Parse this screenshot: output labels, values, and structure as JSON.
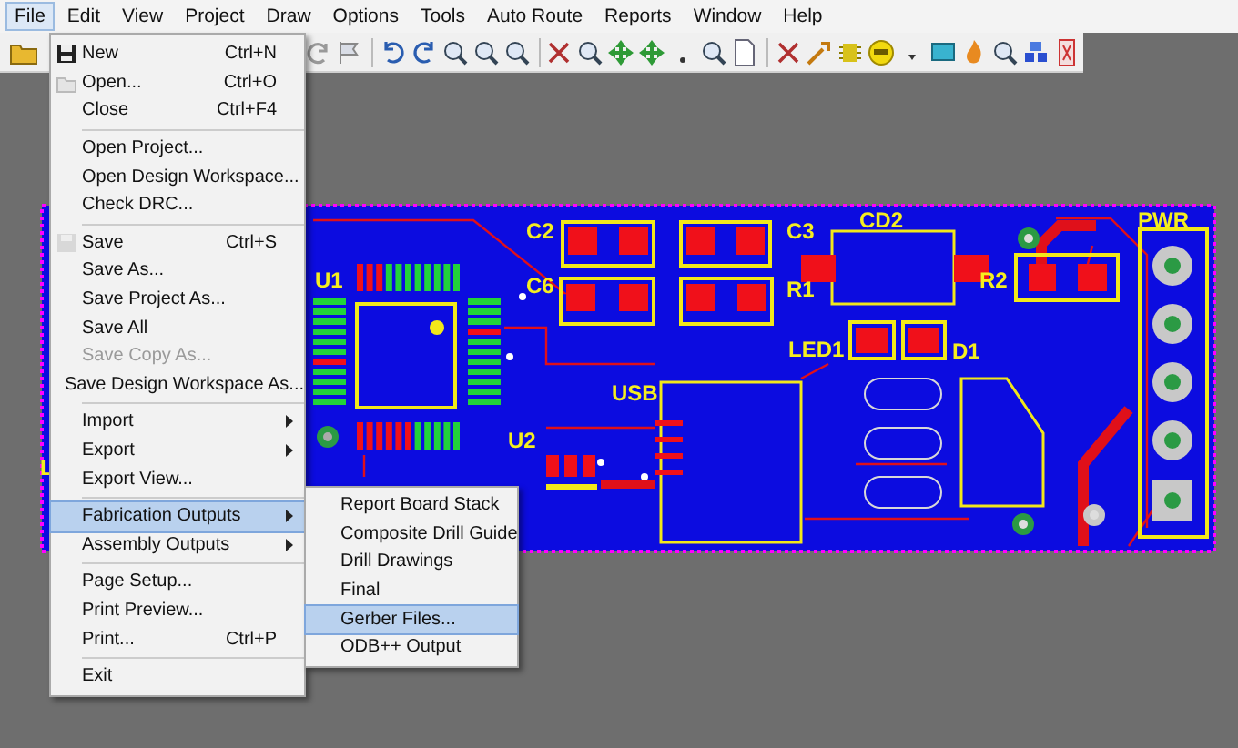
{
  "menubar": [
    {
      "label": "File",
      "selected": true
    },
    {
      "label": "Edit",
      "selected": false
    },
    {
      "label": "View",
      "selected": false
    },
    {
      "label": "Project",
      "selected": false
    },
    {
      "label": "Draw",
      "selected": false
    },
    {
      "label": "Options",
      "selected": false
    },
    {
      "label": "Tools",
      "selected": false
    },
    {
      "label": "Auto Route",
      "selected": false
    },
    {
      "label": "Reports",
      "selected": false
    },
    {
      "label": "Window",
      "selected": false
    },
    {
      "label": "Help",
      "selected": false
    }
  ],
  "board_labels": [
    "C2",
    "C3",
    "CD2",
    "PWR",
    "U1",
    "C6",
    "R1",
    "R2",
    "LED1",
    "D1",
    "USB",
    "U2",
    "L"
  ],
  "file_menu": [
    [
      {
        "label": "New",
        "shortcut": "Ctrl+N",
        "disabled": false,
        "submenu": false,
        "selected": false
      },
      {
        "label": "Open...",
        "shortcut": "Ctrl+O",
        "disabled": false,
        "submenu": false,
        "selected": false
      },
      {
        "label": "Close",
        "shortcut": "Ctrl+F4",
        "disabled": false,
        "submenu": false,
        "selected": false
      }
    ],
    [
      {
        "label": "Open Project...",
        "disabled": false,
        "submenu": false,
        "selected": false
      },
      {
        "label": "Open Design Workspace...",
        "disabled": false,
        "submenu": false,
        "selected": false
      },
      {
        "label": "Check DRC...",
        "disabled": false,
        "submenu": false,
        "selected": false
      }
    ],
    [
      {
        "label": "Save",
        "shortcut": "Ctrl+S",
        "disabled": false,
        "submenu": false,
        "selected": false
      },
      {
        "label": "Save As...",
        "disabled": false,
        "submenu": false,
        "selected": false
      },
      {
        "label": "Save Project As...",
        "disabled": false,
        "submenu": false,
        "selected": false
      },
      {
        "label": "Save All",
        "disabled": false,
        "submenu": false,
        "selected": false
      },
      {
        "label": "Save Copy As...",
        "disabled": true,
        "submenu": false,
        "selected": false
      },
      {
        "label": "Save Design Workspace As...",
        "disabled": false,
        "submenu": false,
        "selected": false
      }
    ],
    [
      {
        "label": "Import",
        "disabled": false,
        "submenu": true,
        "selected": false
      },
      {
        "label": "Export",
        "disabled": false,
        "submenu": true,
        "selected": false
      },
      {
        "label": "Export View...",
        "disabled": false,
        "submenu": false,
        "selected": false
      }
    ],
    [
      {
        "label": "Fabrication Outputs",
        "disabled": false,
        "submenu": true,
        "selected": true
      },
      {
        "label": "Assembly Outputs",
        "disabled": false,
        "submenu": true,
        "selected": false
      }
    ],
    [
      {
        "label": "Page Setup...",
        "disabled": false,
        "submenu": false,
        "selected": false
      },
      {
        "label": "Print Preview...",
        "disabled": false,
        "submenu": false,
        "selected": false
      },
      {
        "label": "Print...",
        "shortcut": "Ctrl+P",
        "disabled": false,
        "submenu": false,
        "selected": false
      }
    ],
    [
      {
        "label": "Exit",
        "disabled": false,
        "submenu": false,
        "selected": false
      }
    ]
  ],
  "submenu": [
    {
      "label": "Report Board Stack",
      "selected": false
    },
    {
      "label": "Composite Drill Guide",
      "selected": false
    },
    {
      "label": "Drill Drawings",
      "selected": false
    },
    {
      "label": "Final",
      "selected": false
    },
    {
      "label": "Gerber Files...",
      "selected": true
    },
    {
      "label": "ODB++ Output",
      "selected": false
    }
  ]
}
